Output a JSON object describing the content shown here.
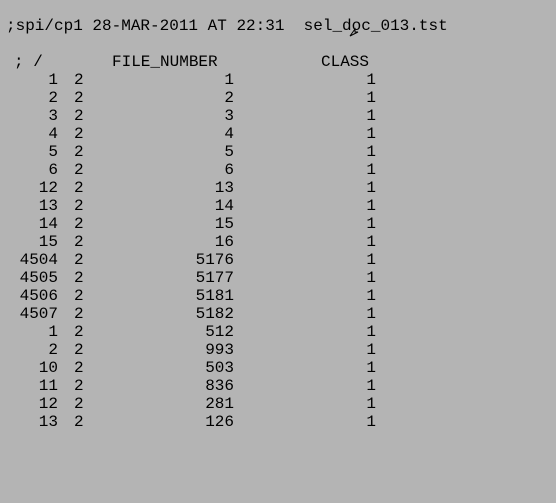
{
  "title": ";spi/cp1 28-MAR-2011 AT 22:31  sel_doc_013.tst",
  "cursor_icon": "arrow-cursor-icon",
  "header": {
    "col_a": "; /",
    "col_c": "FILE_NUMBER",
    "col_d": "CLASS"
  },
  "rows": [
    {
      "a": "1",
      "b": "2",
      "c": "1",
      "d": "1"
    },
    {
      "a": "2",
      "b": "2",
      "c": "2",
      "d": "1"
    },
    {
      "a": "3",
      "b": "2",
      "c": "3",
      "d": "1"
    },
    {
      "a": "4",
      "b": "2",
      "c": "4",
      "d": "1"
    },
    {
      "a": "5",
      "b": "2",
      "c": "5",
      "d": "1"
    },
    {
      "a": "6",
      "b": "2",
      "c": "6",
      "d": "1"
    },
    {
      "a": "12",
      "b": "2",
      "c": "13",
      "d": "1"
    },
    {
      "a": "13",
      "b": "2",
      "c": "14",
      "d": "1"
    },
    {
      "a": "14",
      "b": "2",
      "c": "15",
      "d": "1"
    },
    {
      "a": "15",
      "b": "2",
      "c": "16",
      "d": "1"
    },
    {
      "a": "4504",
      "b": "2",
      "c": "5176",
      "d": "1"
    },
    {
      "a": "4505",
      "b": "2",
      "c": "5177",
      "d": "1"
    },
    {
      "a": "4506",
      "b": "2",
      "c": "5181",
      "d": "1"
    },
    {
      "a": "4507",
      "b": "2",
      "c": "5182",
      "d": "1"
    },
    {
      "a": "1",
      "b": "2",
      "c": "512",
      "d": "1"
    },
    {
      "a": "2",
      "b": "2",
      "c": "993",
      "d": "1"
    },
    {
      "a": "10",
      "b": "2",
      "c": "503",
      "d": "1"
    },
    {
      "a": "11",
      "b": "2",
      "c": "836",
      "d": "1"
    },
    {
      "a": "12",
      "b": "2",
      "c": "281",
      "d": "1"
    },
    {
      "a": "13",
      "b": "2",
      "c": "126",
      "d": "1"
    }
  ]
}
